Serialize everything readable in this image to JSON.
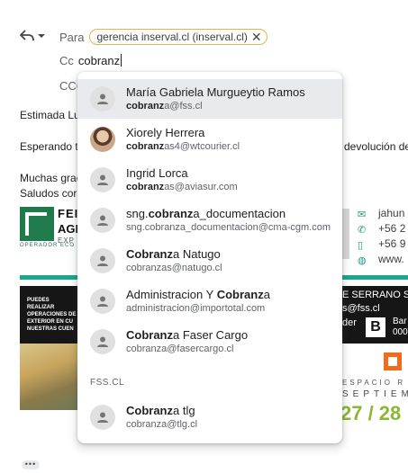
{
  "compose": {
    "to_label": "Para",
    "to_chip": "gerencia inserval.cl (inserval.cl)",
    "cc_label": "Cc",
    "cc_value": "cobranz",
    "cco_label": "CCO"
  },
  "background": {
    "greeting": "Estimada Lu",
    "line2_start": "Esperando t",
    "line2_end": "devolución de",
    "thanks": "Muchas grac",
    "regards": "Saludos cor",
    "logo_word1": "FEI",
    "logo_word2": "AGE",
    "logo_word3": "EXP",
    "logo_sub": "OPERADOR ECO",
    "band_text": "PUEDES REALIZAR OPERACIONES DE EXTERIOR EN CU NUESTRAS CUEN",
    "band_right1": "E SERRANO SC",
    "band_right2": "s@fss.cl",
    "band_right3": "der",
    "band_right4a": "Bar",
    "band_right4b": "000",
    "contact1": "jahun",
    "contact2": "+56 2",
    "contact3": "+56 9",
    "contact4": "www.",
    "espacio": "ESPACIO R",
    "septiem": "SEPTIEM",
    "dates": "27 / 28",
    "more": "•••"
  },
  "dropdown": {
    "section_label": "FSS.CL",
    "items": [
      {
        "name_pre": "María Gabriela Murgueytio Ramos",
        "name_bold": "",
        "name_post": "",
        "email_bold": "cobranz",
        "email_rest": "a@fss.cl"
      },
      {
        "name_pre": "Xiorely Herrera",
        "name_bold": "",
        "name_post": "",
        "email_bold": "cobranz",
        "email_rest": "as4@wtcourier.cl"
      },
      {
        "name_pre": "Ingrid Lorca",
        "name_bold": "",
        "name_post": "",
        "email_bold": "cobranz",
        "email_rest": "as@aviasur.com"
      },
      {
        "name_pre": "sng.",
        "name_bold": "cobranz",
        "name_post": "a_documentacion",
        "email_bold": "",
        "email_rest": "sng.cobranza_documentacion@cma-cgm.com"
      },
      {
        "name_pre": "",
        "name_bold": "Cobranz",
        "name_post": "a Natugo",
        "email_bold": "",
        "email_rest": "cobranzas@natugo.cl"
      },
      {
        "name_pre": "Administracion Y ",
        "name_bold": "Cobranz",
        "name_post": "a",
        "email_bold": "",
        "email_rest": "administracion@importotal.com"
      },
      {
        "name_pre": "",
        "name_bold": "Cobranz",
        "name_post": "a Faser Cargo",
        "email_bold": "",
        "email_rest": "cobranza@fasercargo.cl"
      },
      {
        "name_pre": "",
        "name_bold": "Cobranz",
        "name_post": "a tlg",
        "email_bold": "",
        "email_rest": "cobranza@tlg.cl"
      }
    ]
  },
  "colors": {
    "chip_border": "#e6b34a",
    "highlight": "#e8eaed",
    "brand_green": "#1aa78a"
  },
  "icons": {
    "reply": "reply-icon",
    "dropdown": "chevron-down-icon",
    "remove": "close-icon",
    "avatar": "person-icon"
  }
}
